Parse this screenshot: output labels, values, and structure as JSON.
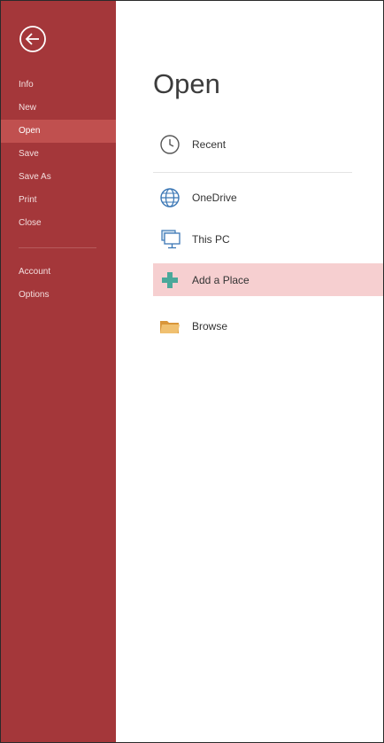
{
  "nav": {
    "items": [
      {
        "label": "Info"
      },
      {
        "label": "New"
      },
      {
        "label": "Open",
        "selected": true
      },
      {
        "label": "Save"
      },
      {
        "label": "Save As"
      },
      {
        "label": "Print"
      },
      {
        "label": "Close"
      }
    ],
    "secondary": [
      {
        "label": "Account"
      },
      {
        "label": "Options"
      }
    ]
  },
  "main": {
    "title": "Open",
    "recent": {
      "label": "Recent",
      "icon": "clock-icon"
    },
    "places": [
      {
        "label": "OneDrive",
        "icon": "globe-icon"
      },
      {
        "label": "This PC",
        "icon": "computer-icon"
      },
      {
        "label": "Add a Place",
        "icon": "plus-icon",
        "highlighted": true
      },
      {
        "label": "Browse",
        "icon": "folder-icon"
      }
    ]
  },
  "colors": {
    "sidebar": "#a4373a",
    "sidebar_selected": "#c0504f",
    "highlight": "#f6cfd0",
    "plus": "#4aa89a",
    "folder": "#e8b04a",
    "globe": "#3b77b5"
  }
}
